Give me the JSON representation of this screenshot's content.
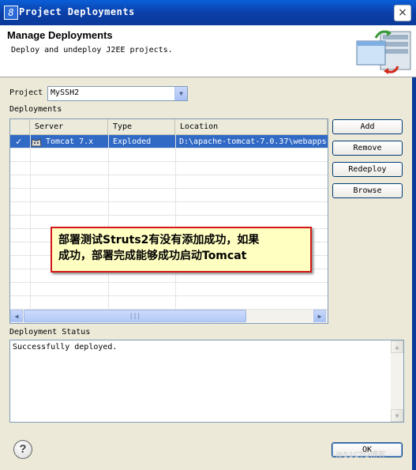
{
  "window": {
    "title": "Project Deployments",
    "close_symbol": "×"
  },
  "header": {
    "title": "Manage Deployments",
    "subtitle": "Deploy and undeploy J2EE projects."
  },
  "project": {
    "label": "Project",
    "value": "MySSH2"
  },
  "deployments": {
    "label": "Deployments",
    "columns": [
      "Server",
      "Type",
      "Location"
    ],
    "rows": [
      {
        "check": "✓",
        "server": "Tomcat  7.x",
        "type": "Exploded",
        "location": "D:\\apache-tomcat-7.0.37\\webapps"
      }
    ]
  },
  "buttons": {
    "add": "Add",
    "remove": "Remove",
    "redeploy": "Redeploy",
    "browse": "Browse",
    "ok": "OK",
    "help": "?"
  },
  "status": {
    "label": "Deployment Status",
    "text": "Successfully deployed."
  },
  "annotation": {
    "line1": "部署测试Struts2有没有添加成功，如果",
    "line2": "成功，部署完成能够成功启动Tomcat"
  },
  "watermark": "@51CTO博客"
}
